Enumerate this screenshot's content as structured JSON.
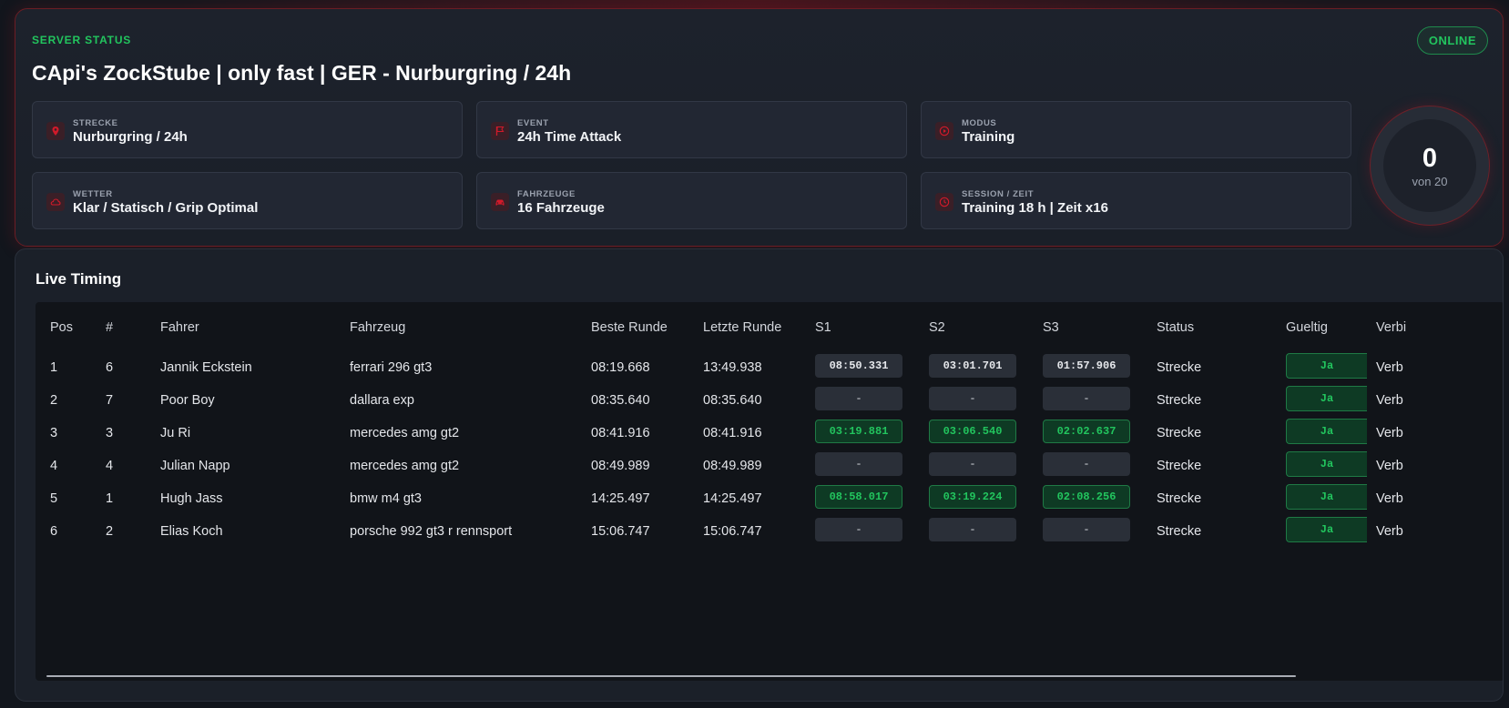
{
  "server": {
    "label": "SERVER STATUS",
    "title": "CApi's ZockStube | only fast | GER - Nurburgring / 24h",
    "status": "ONLINE",
    "accent_color": "#22c55e",
    "brand_color": "#c8102e",
    "info": [
      {
        "label": "STRECKE",
        "value": "Nurburgring / 24h",
        "icon": "location-pin-icon"
      },
      {
        "label": "EVENT",
        "value": "24h Time Attack",
        "icon": "flag-icon"
      },
      {
        "label": "MODUS",
        "value": "Training",
        "icon": "play-circle-icon"
      },
      {
        "label": "WETTER",
        "value": "Klar / Statisch / Grip Optimal",
        "icon": "cloud-icon"
      },
      {
        "label": "FAHRZEUGE",
        "value": "16 Fahrzeuge",
        "icon": "car-icon"
      },
      {
        "label": "SESSION / ZEIT",
        "value": "Training 18 h | Zeit x16",
        "icon": "clock-icon"
      }
    ],
    "players": {
      "count": "0",
      "max_label": "von 20"
    }
  },
  "timing": {
    "title": "Live Timing",
    "columns": [
      "Pos",
      "#",
      "Fahrer",
      "Fahrzeug",
      "Beste Runde",
      "Letzte Runde",
      "S1",
      "S2",
      "S3",
      "Status",
      "Gueltig",
      "Verbi"
    ],
    "rows": [
      {
        "pos": "1",
        "num": "6",
        "driver": "Jannik Eckstein",
        "car": "ferrari 296 gt3",
        "best": "08:19.668",
        "last": "13:49.938",
        "s1": "08:50.331",
        "s2": "03:01.701",
        "s3": "01:57.906",
        "sector_style": "neutral",
        "status": "Strecke",
        "valid": "Ja",
        "conn": "Verb"
      },
      {
        "pos": "2",
        "num": "7",
        "driver": "Poor Boy",
        "car": "dallara exp",
        "best": "08:35.640",
        "last": "08:35.640",
        "s1": "-",
        "s2": "-",
        "s3": "-",
        "sector_style": "plain",
        "status": "Strecke",
        "valid": "Ja",
        "conn": "Verb"
      },
      {
        "pos": "3",
        "num": "3",
        "driver": "Ju Ri",
        "car": "mercedes amg gt2",
        "best": "08:41.916",
        "last": "08:41.916",
        "s1": "03:19.881",
        "s2": "03:06.540",
        "s3": "02:02.637",
        "sector_style": "green",
        "status": "Strecke",
        "valid": "Ja",
        "conn": "Verb"
      },
      {
        "pos": "4",
        "num": "4",
        "driver": "Julian Napp",
        "car": "mercedes amg gt2",
        "best": "08:49.989",
        "last": "08:49.989",
        "s1": "-",
        "s2": "-",
        "s3": "-",
        "sector_style": "plain",
        "status": "Strecke",
        "valid": "Ja",
        "conn": "Verb"
      },
      {
        "pos": "5",
        "num": "1",
        "driver": "Hugh Jass",
        "car": "bmw m4 gt3",
        "best": "14:25.497",
        "last": "14:25.497",
        "s1": "08:58.017",
        "s2": "03:19.224",
        "s3": "02:08.256",
        "sector_style": "green",
        "status": "Strecke",
        "valid": "Ja",
        "conn": "Verb"
      },
      {
        "pos": "6",
        "num": "2",
        "driver": "Elias Koch",
        "car": "porsche 992 gt3 r rennsport",
        "best": "15:06.747",
        "last": "15:06.747",
        "s1": "-",
        "s2": "-",
        "s3": "-",
        "sector_style": "plain",
        "status": "Strecke",
        "valid": "Ja",
        "conn": "Verb"
      }
    ]
  }
}
